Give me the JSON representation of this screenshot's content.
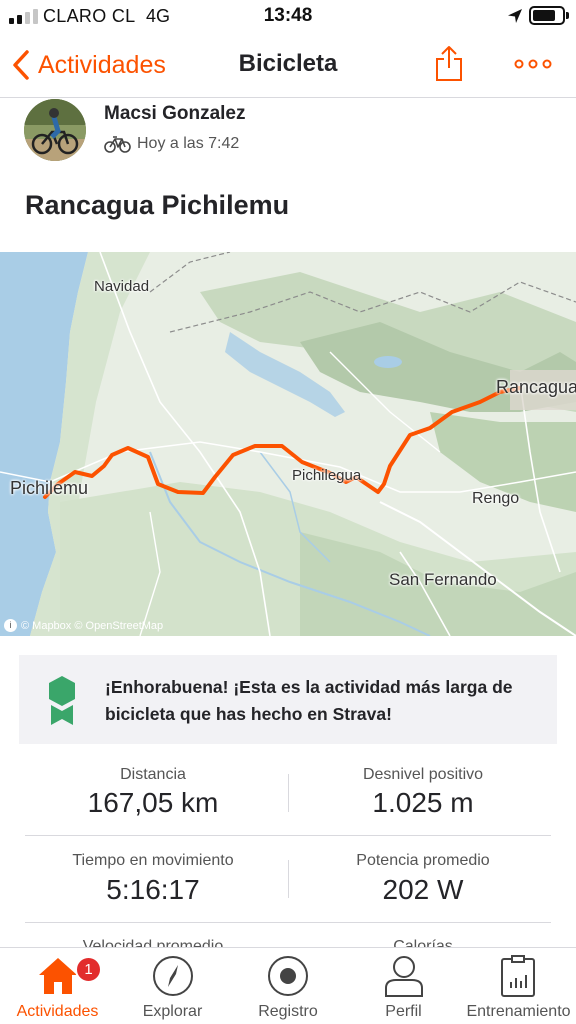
{
  "status_bar": {
    "carrier": "CLARO CL",
    "network": "4G",
    "time": "13:48",
    "battery_level": 0.8
  },
  "nav": {
    "back_label": "Actividades",
    "title": "Bicicleta",
    "accent_color": "#fc5200"
  },
  "athlete": {
    "name": "Macsi Gonzalez",
    "time": "Hoy a las 7:42",
    "sport_icon": "bicycle-icon"
  },
  "activity": {
    "title": "Rancagua Pichilemu"
  },
  "map": {
    "route_color": "#fc5200",
    "labels": {
      "navidad": "Navidad",
      "rancagua": "Rancagua",
      "pichilemu": "Pichilemu",
      "peralillo": "Pichilegua",
      "rengo": "Rengo",
      "san_fernando": "San Fernando"
    },
    "attribution": "© Mapbox © OpenStreetMap"
  },
  "achievement": {
    "text": "¡Enhorabuena! ¡Esta es la actividad más larga de bicicleta que has hecho en Strava!",
    "badge_color": "#3aa66a"
  },
  "stats": [
    {
      "label": "Distancia",
      "value": "167,05 km"
    },
    {
      "label": "Desnivel positivo",
      "value": "1.025 m"
    },
    {
      "label": "Tiempo en movimiento",
      "value": "5:16:17"
    },
    {
      "label": "Potencia promedio",
      "value": "202 W"
    },
    {
      "label": "Velocidad promedio",
      "value": ""
    },
    {
      "label": "Calorías",
      "value": ""
    }
  ],
  "tabbar": {
    "items": [
      {
        "label": "Actividades",
        "icon": "home-icon",
        "active": true,
        "badge": "1"
      },
      {
        "label": "Explorar",
        "icon": "compass-icon"
      },
      {
        "label": "Registro",
        "icon": "record-icon"
      },
      {
        "label": "Perfil",
        "icon": "profile-icon"
      },
      {
        "label": "Entrenamiento",
        "icon": "training-icon"
      }
    ]
  }
}
